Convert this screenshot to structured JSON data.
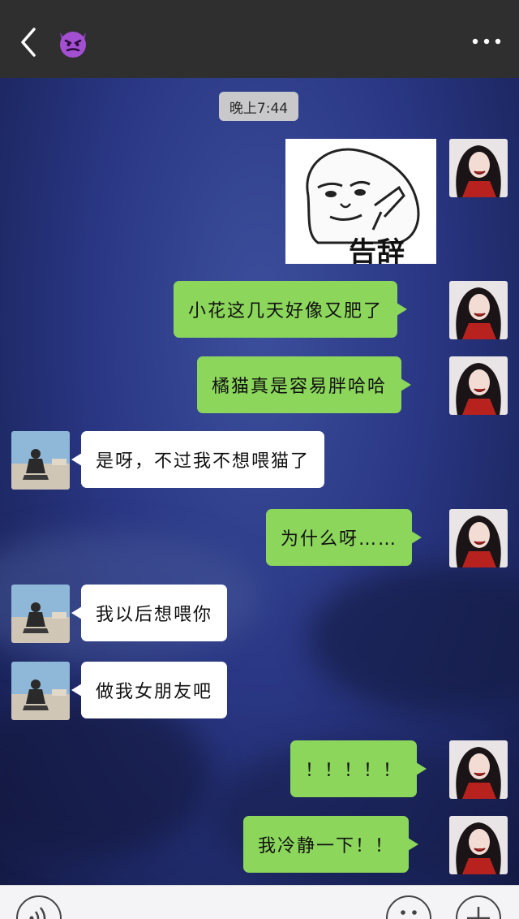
{
  "header": {
    "back_icon": "chevron-left-icon",
    "title_icon": "smiling-devil-emoji-icon",
    "more_icon": "more-dots-icon"
  },
  "chat": {
    "timestamp": "晚上7:44",
    "sticker": {
      "text": "告辞"
    },
    "messages": [
      {
        "sender": "me",
        "text": "小花这几天好像又肥了"
      },
      {
        "sender": "me",
        "text": "橘猫真是容易胖哈哈"
      },
      {
        "sender": "friend",
        "text": "是呀，不过我不想喂猫了"
      },
      {
        "sender": "me",
        "text": "为什么呀……"
      },
      {
        "sender": "friend",
        "text": "我以后想喂你"
      },
      {
        "sender": "friend",
        "text": "做我女朋友吧"
      },
      {
        "sender": "me",
        "text": "！！！！！"
      },
      {
        "sender": "me",
        "text": "我冷静一下！！"
      }
    ]
  },
  "bottom_bar": {
    "voice_icon": "voice-icon",
    "emoji_icon": "emoji-icon",
    "plus_icon": "plus-icon"
  },
  "colors": {
    "header_bg": "#2f2f30",
    "my_bubble": "#8bd65b",
    "friend_bubble": "#ffffff",
    "timestamp_bg": "#c9c9cb"
  }
}
